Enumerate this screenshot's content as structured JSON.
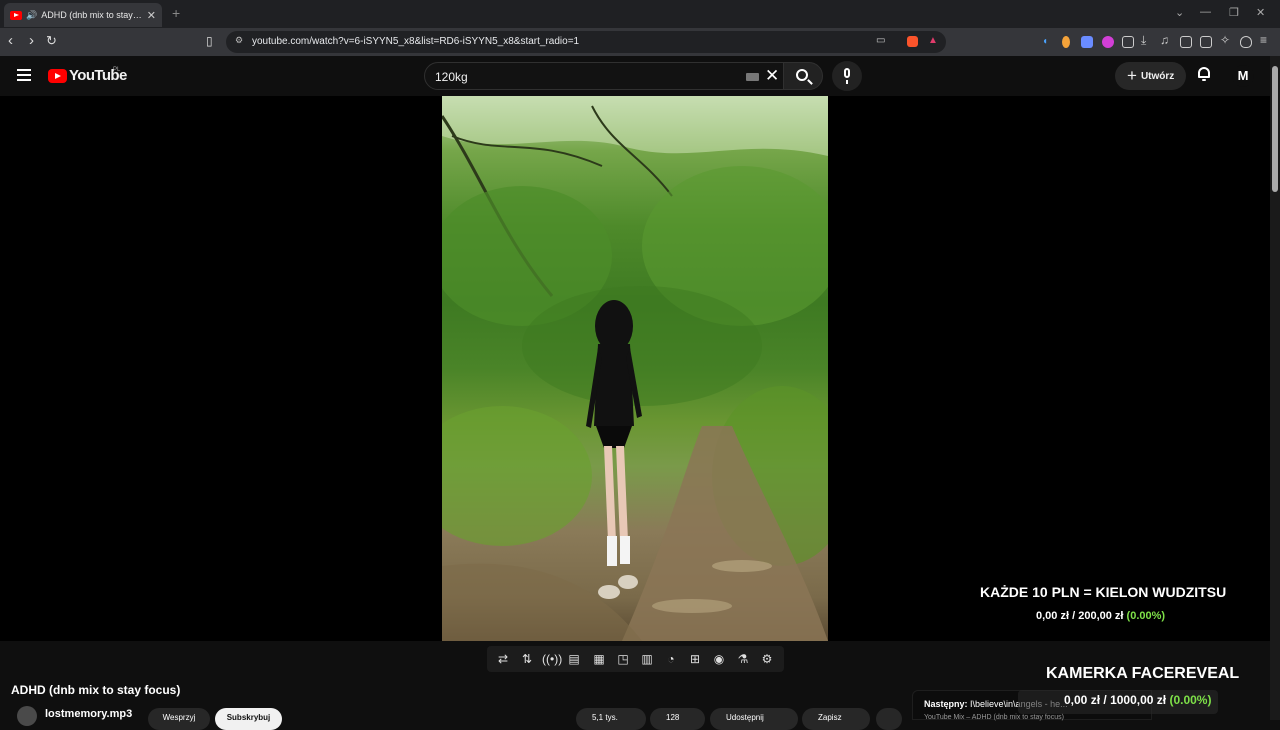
{
  "browser": {
    "tab_title": "ADHD (dnb mix to stay focus)",
    "new_tab": "+",
    "url": "youtube.com/watch?v=6-iSYYN5_x8&list=RD6-iSYYN5_x8&start_radio=1"
  },
  "youtube": {
    "logo_text": "YouTube",
    "logo_region": "PL",
    "search_value": "120kg",
    "create_label": "Utwórz",
    "avatar_letter": "M"
  },
  "overlay": {
    "goal1_title": "KAŻDE 10 PLN = KIELON WUDZITSU",
    "goal1_current": "0,00 zł",
    "goal1_sep": "/",
    "goal1_target": "200,00 zł",
    "goal1_percent": "(0.00%)",
    "goal2_title": "KAMERKA FACEREVEAL",
    "goal2_current": "0,00 zł",
    "goal2_sep": "/",
    "goal2_target": "1000,00 zł",
    "goal2_percent": "(0.00%)"
  },
  "video": {
    "title": "ADHD (dnb mix to stay focus)",
    "channel": "lostmemory.mp3",
    "join_label": "Wesprzyj",
    "subscribe_label": "Subskrybuj",
    "likes": "5,1 tys.",
    "saves": "128",
    "share_label": "Udostępnij",
    "save_label": "Zapisz"
  },
  "next_up": {
    "label": "Następny:",
    "title": "I\\believe\\in\\angels - he...",
    "subtitle": "YouTube Mix – ADHD (dnb mix to stay focus)"
  },
  "colors": {
    "youtube_red": "#ff0000",
    "goal_green": "#7ee048",
    "background": "#0f0f0f"
  }
}
